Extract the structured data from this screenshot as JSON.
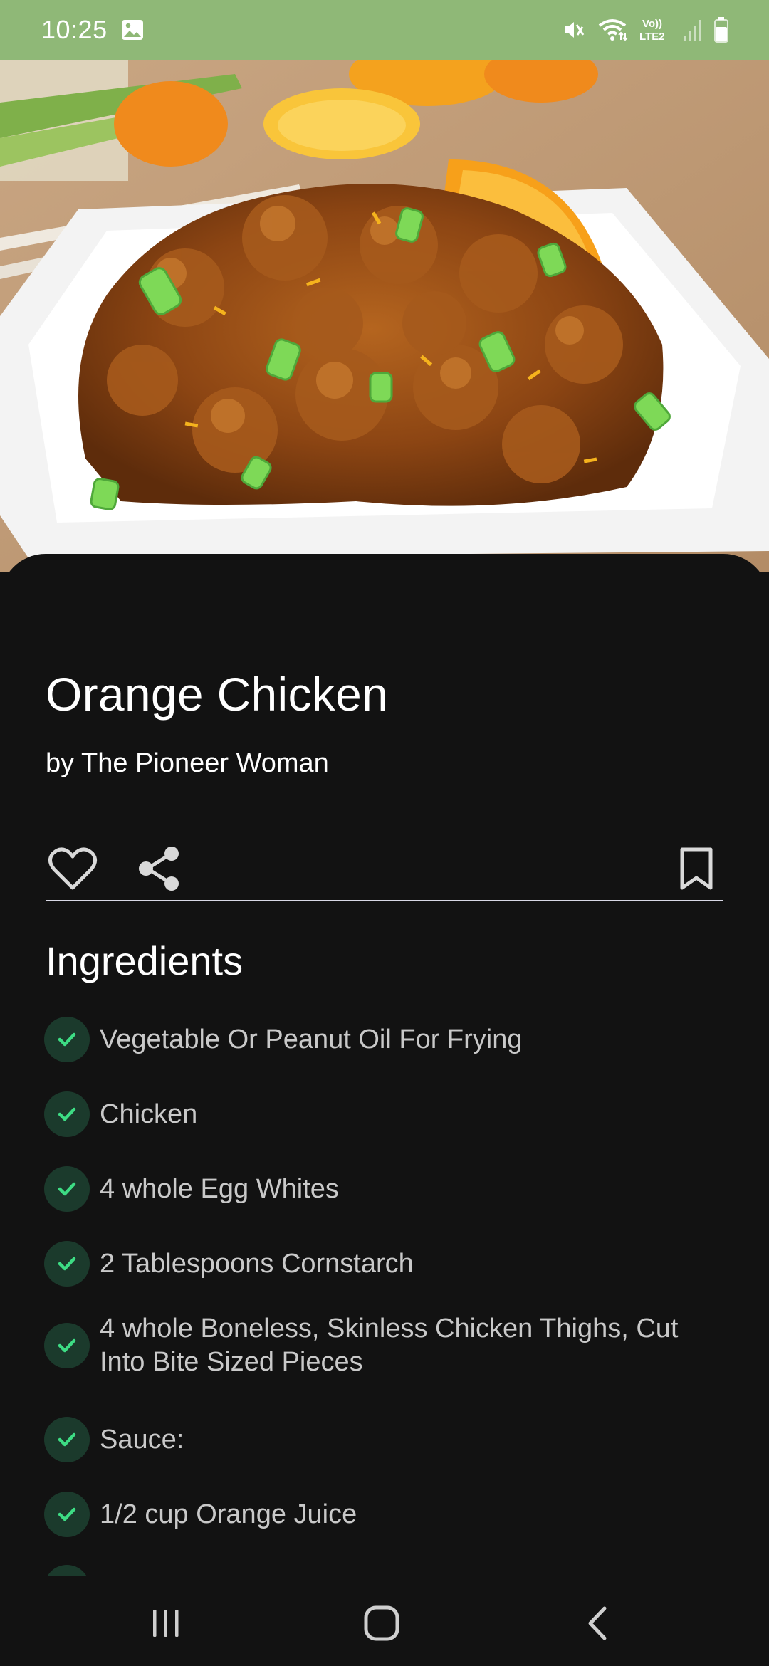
{
  "status_bar": {
    "time": "10:25",
    "icons": [
      "gallery-icon",
      "mute-icon",
      "wifi-icon",
      "volte-icon",
      "signal-icon",
      "battery-icon"
    ],
    "volte_top": "Vo))",
    "volte_bottom": "LTE2"
  },
  "hero": {
    "image": "orange-chicken-photo"
  },
  "recipe": {
    "title": "Orange Chicken",
    "author": "by The Pioneer Woman"
  },
  "actions": {
    "icons": [
      "heart-icon",
      "share-icon",
      "bookmark-icon"
    ]
  },
  "ingredients": {
    "heading": "Ingredients",
    "items": [
      {
        "line1": "Vegetable Or Peanut Oil For Frying",
        "line2": ""
      },
      {
        "line1": "Chicken",
        "line2": ""
      },
      {
        "line1": "4 whole Egg Whites",
        "line2": ""
      },
      {
        "line1": "2 Tablespoons Cornstarch",
        "line2": ""
      },
      {
        "line1": "4 whole Boneless, Skinless Chicken Thighs, Cut",
        "line2": "Into Bite Sized Pieces"
      },
      {
        "line1": "Sauce:",
        "line2": ""
      },
      {
        "line1": "1/2 cup Orange Juice",
        "line2": ""
      }
    ]
  },
  "nav_bar": {
    "icons": [
      "recents-icon",
      "home-icon",
      "back-icon"
    ]
  },
  "colors": {
    "status_bar": "#8fb877",
    "background": "#121212",
    "check_bg": "#1b3a2c",
    "check_mark": "#3ddc84",
    "text_primary": "#ffffff",
    "text_secondary": "#c9c9c9"
  }
}
